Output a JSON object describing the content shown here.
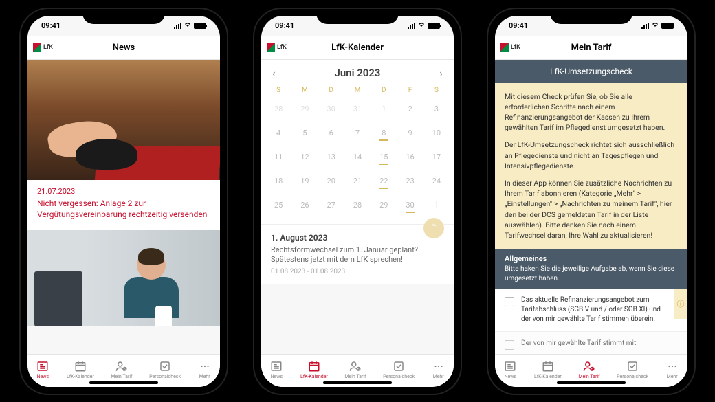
{
  "status_time": "09:41",
  "logo_text": "LfK",
  "phone1": {
    "title": "News",
    "article": {
      "date": "21.07.2023",
      "headline": "Nicht vergessen: Anlage 2 zur Vergütungsvereinbarung rechtzeitig versenden"
    }
  },
  "phone2": {
    "title": "LfK-Kalender",
    "month": "Juni 2023",
    "dow": [
      "S",
      "M",
      "D",
      "M",
      "D",
      "F",
      "S"
    ],
    "weeks": [
      [
        "28",
        "29",
        "30",
        "31",
        "1",
        "2",
        "3"
      ],
      [
        "4",
        "5",
        "6",
        "7",
        "8",
        "9",
        "10"
      ],
      [
        "11",
        "12",
        "13",
        "14",
        "15",
        "16",
        "17"
      ],
      [
        "18",
        "19",
        "20",
        "21",
        "22",
        "23",
        "24"
      ],
      [
        "25",
        "26",
        "27",
        "28",
        "29",
        "30",
        "1"
      ]
    ],
    "event": {
      "date_label": "1. August 2023",
      "text": "Rechtsformwechsel zum 1. Januar geplant? Spätestens jetzt mit dem LfK sprechen!",
      "range": "01.08.2023 - 01.08.2023"
    }
  },
  "phone3": {
    "title": "Mein Tarif",
    "section_head": "LfK-Umsetzungscheck",
    "info_p1": "Mit diesem Check prüfen Sie, ob Sie alle erforderlichen Schritte nach einem Refinanzierungsangebot der Kassen zu Ihrem gewählten Tarif im Pflegedienst umgesetzt haben.",
    "info_p2": "Der LfK-Umsetzungscheck richtet sich ausschließlich an Pflegedienste und nicht an Tagespflegen und Intensivpflegedienste.",
    "info_p3": "In dieser App können Sie zusätzliche Nachrichten zu Ihrem Tarif abonnieren (Kategorie „Mehr\" > „Einstellungen\" > „Nachrichten zu meinem Tarif\", hier den bei der DCS gemeldeten Tarif in der Liste auswählen). Bitte denken Sie nach einem Tarifwechsel daran, Ihre Wahl zu aktualisieren!",
    "allgemeines_title": "Allgemeines",
    "allgemeines_sub": "Bitte haken Sie die jeweilige Aufgabe ab, wenn Sie diese umgesetzt haben.",
    "task1": "Das aktuelle Refinanzierungsangebot zum Tarifabschluss (SGB V und / oder SGB XI) und der von mir gewählte Tarif stimmen überein.",
    "task2": "Der von mir gewählte Tarif stimmt mit"
  },
  "tabs": {
    "news": "News",
    "kalender": "LfK-Kalender",
    "tarif": "Mein Tarif",
    "check": "Personalcheck",
    "mehr": "Mehr"
  }
}
